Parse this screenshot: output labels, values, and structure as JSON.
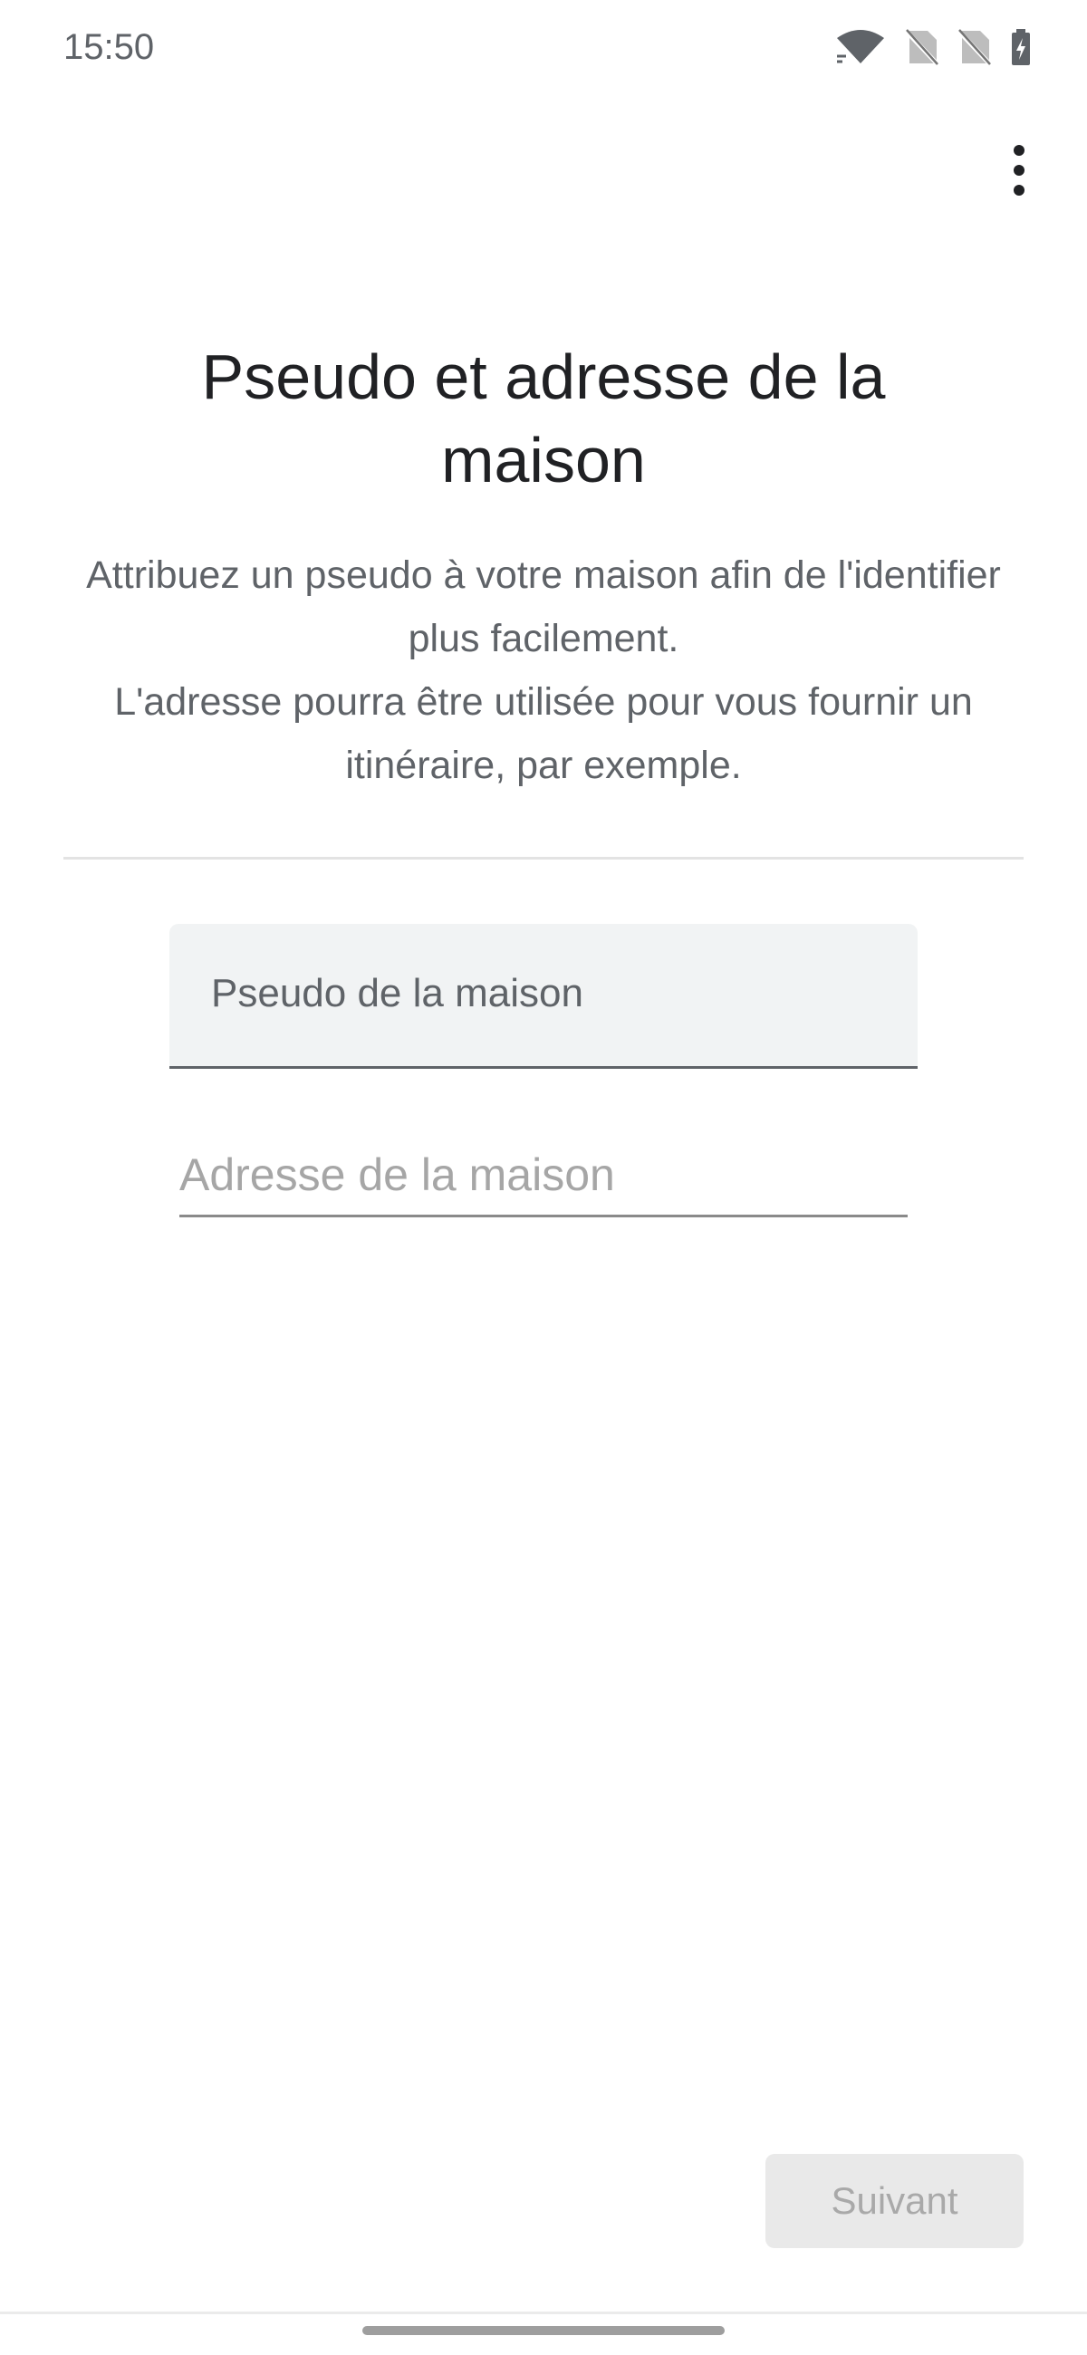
{
  "status_bar": {
    "time": "15:50",
    "icons": [
      "wifi-icon",
      "no-sim-icon",
      "no-sim-icon",
      "battery-charging-icon"
    ]
  },
  "toolbar": {
    "overflow_icon": "more-vert-icon"
  },
  "page": {
    "title": "Pseudo et adresse de la maison",
    "description_line1": "Attribuez un pseudo à votre maison afin de l'identifier plus facilement.",
    "description_line2": "L'adresse pourra être utilisée pour vous fournir un itinéraire, par exemple."
  },
  "form": {
    "nickname_label": "Pseudo de la maison",
    "nickname_value": "",
    "address_placeholder": "Adresse de la maison",
    "address_value": ""
  },
  "footer": {
    "next_label": "Suivant",
    "next_enabled": false
  },
  "colors": {
    "background": "#ffffff",
    "title": "#202124",
    "secondary_text": "#5f6368",
    "field_fill": "#f1f3f4",
    "disabled_button_bg": "#e9e9e9",
    "disabled_button_text": "#a9a9a9"
  }
}
